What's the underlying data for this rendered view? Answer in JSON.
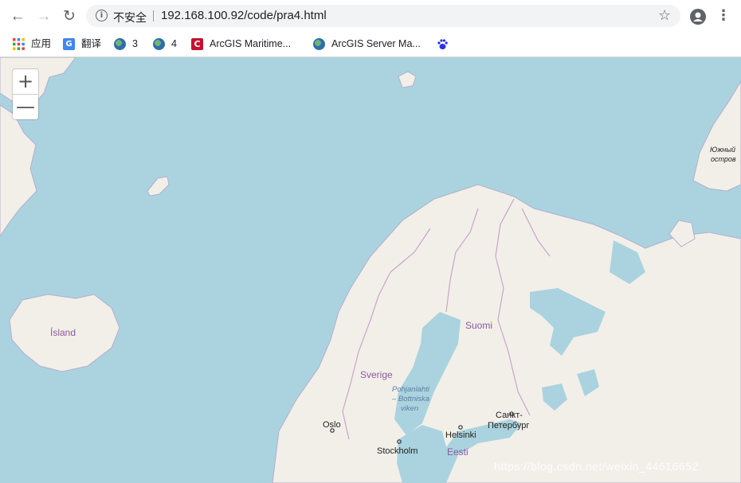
{
  "browser": {
    "security_label": "不安全",
    "url": "192.168.100.92/code/pra4.html",
    "info_glyph": "i",
    "back_glyph": "←",
    "forward_glyph": "→",
    "reload_glyph": "↻",
    "star_glyph": "☆",
    "menu_glyph": "⋮"
  },
  "bookmarks": [
    {
      "label": "应用",
      "icon": "apps-grid-icon"
    },
    {
      "label": "翻译",
      "icon": "google-translate-icon"
    },
    {
      "label": "3",
      "icon": "globe-icon"
    },
    {
      "label": "4",
      "icon": "globe-icon"
    },
    {
      "label": "ArcGIS Maritime...",
      "icon": "arcgis-c-icon"
    },
    {
      "label": "ArcGIS Server Ma...",
      "icon": "globe-icon"
    },
    {
      "label": "",
      "icon": "baidu-paw-icon"
    }
  ],
  "map": {
    "zoom_in": "+",
    "zoom_out": "—",
    "colors": {
      "water": "#aad3df",
      "land": "#f2efe9",
      "border": "#9e9cbd"
    },
    "labels": {
      "iceland": "Ísland",
      "finland": "Suomi",
      "sweden": "Sverige",
      "gulf": [
        "Pohjanlahti",
        "– Bottniska",
        "viken"
      ],
      "oslo": "Oslo",
      "stockholm": "Stockholm",
      "helsinki": "Helsinki",
      "spb": [
        "Санкт-",
        "Петербург"
      ],
      "estonia": "Eesti",
      "novaya_zemlya": [
        "Южный",
        "остров"
      ]
    },
    "watermark": "https://blog.csdn.net/weixin_44616652"
  }
}
